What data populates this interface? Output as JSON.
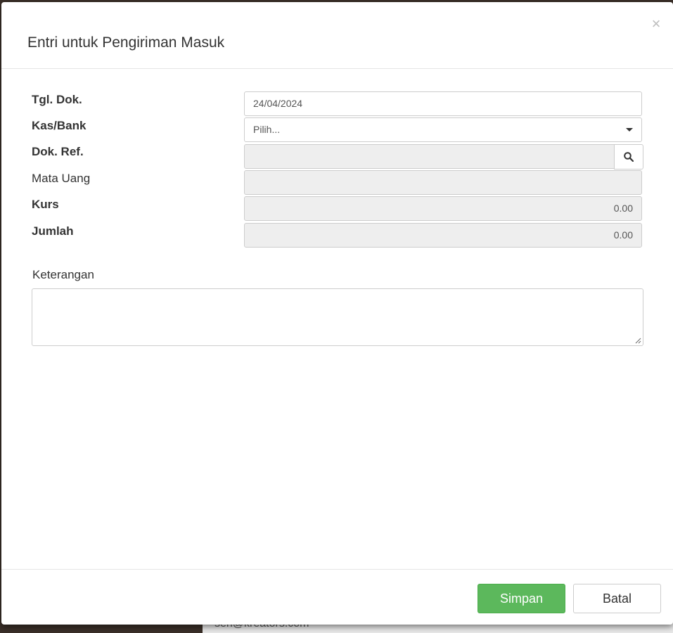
{
  "backdrop": {
    "text": "sen@kreators.com"
  },
  "modal": {
    "title": "Entri untuk Pengiriman Masuk",
    "close_symbol": "×"
  },
  "form": {
    "tgl_dok": {
      "label": "Tgl. Dok.",
      "value": "24/04/2024"
    },
    "kas_bank": {
      "label": "Kas/Bank",
      "value": "Pilih..."
    },
    "dok_ref": {
      "label": "Dok. Ref.",
      "value": ""
    },
    "mata_uang": {
      "label": "Mata Uang",
      "value": ""
    },
    "kurs": {
      "label": "Kurs",
      "value": "0.00"
    },
    "jumlah": {
      "label": "Jumlah",
      "value": "0.00"
    },
    "keterangan": {
      "label": "Keterangan",
      "value": ""
    }
  },
  "footer": {
    "save_label": "Simpan",
    "cancel_label": "Batal"
  },
  "icons": {
    "search": "search-icon",
    "caret": "caret-down-icon",
    "close": "close-icon"
  },
  "colors": {
    "primary_green": "#5cb85c",
    "readonly_bg": "#eeeeee"
  }
}
